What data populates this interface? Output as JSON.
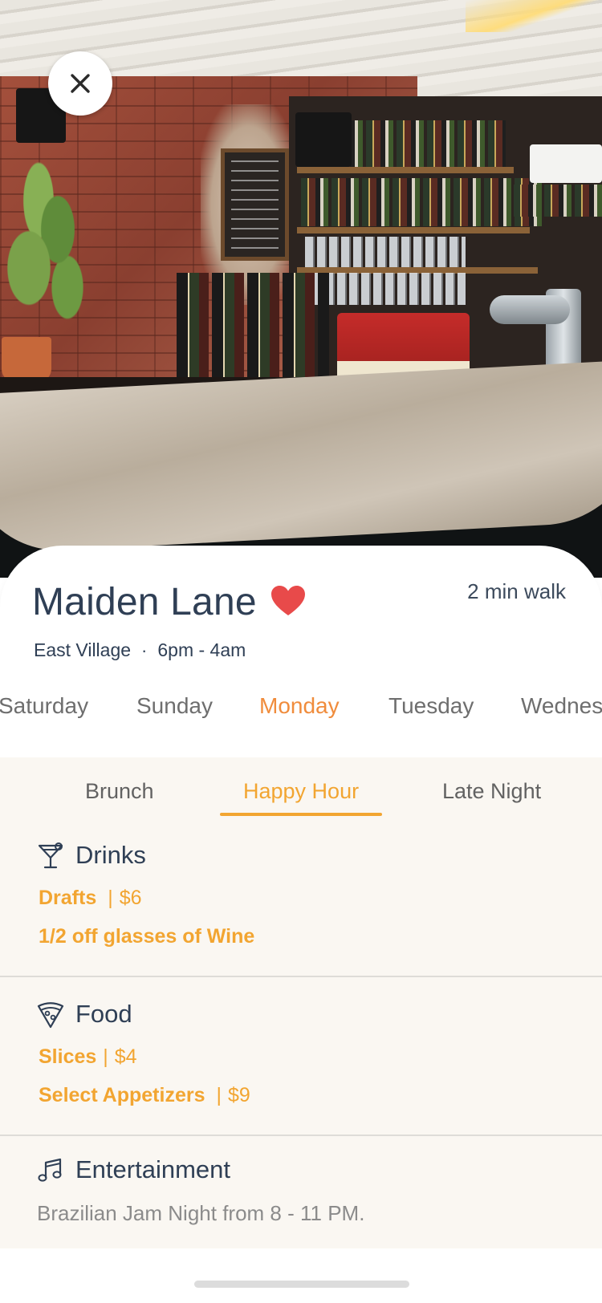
{
  "venue": {
    "name": "Maiden Lane",
    "walk_time": "2 min walk",
    "neighborhood": "East Village",
    "separator": "·",
    "hours": "6pm - 4am",
    "favorite_color": "#e84a4a"
  },
  "days": [
    "Saturday",
    "Sunday",
    "Monday",
    "Tuesday",
    "Wednes"
  ],
  "selected_day": "Monday",
  "meal_tabs": [
    "Brunch",
    "Happy Hour",
    "Late Night"
  ],
  "selected_meal_tab": "Happy Hour",
  "drinks": {
    "title": "Drinks",
    "icon": "cocktail-icon",
    "items": [
      {
        "name": "Drafts",
        "sep": "|",
        "price": "$6"
      },
      {
        "name": "1/2 off glasses of Wine"
      }
    ]
  },
  "food": {
    "title": "Food",
    "icon": "pizza-icon",
    "items": [
      {
        "name": "Slices",
        "sep": "|",
        "price": "$4"
      },
      {
        "name": "Select Appetizers",
        "sep": "|",
        "price": "$9"
      }
    ]
  },
  "entertainment": {
    "title": "Entertainment",
    "icon": "music-note-icon",
    "description": "Brazilian Jam Night from 8 - 11 PM."
  },
  "colors": {
    "accent": "#f2a531",
    "day_active": "#f08c3c",
    "text_primary": "#2f3f55",
    "panel_bg": "#faf7f2"
  }
}
